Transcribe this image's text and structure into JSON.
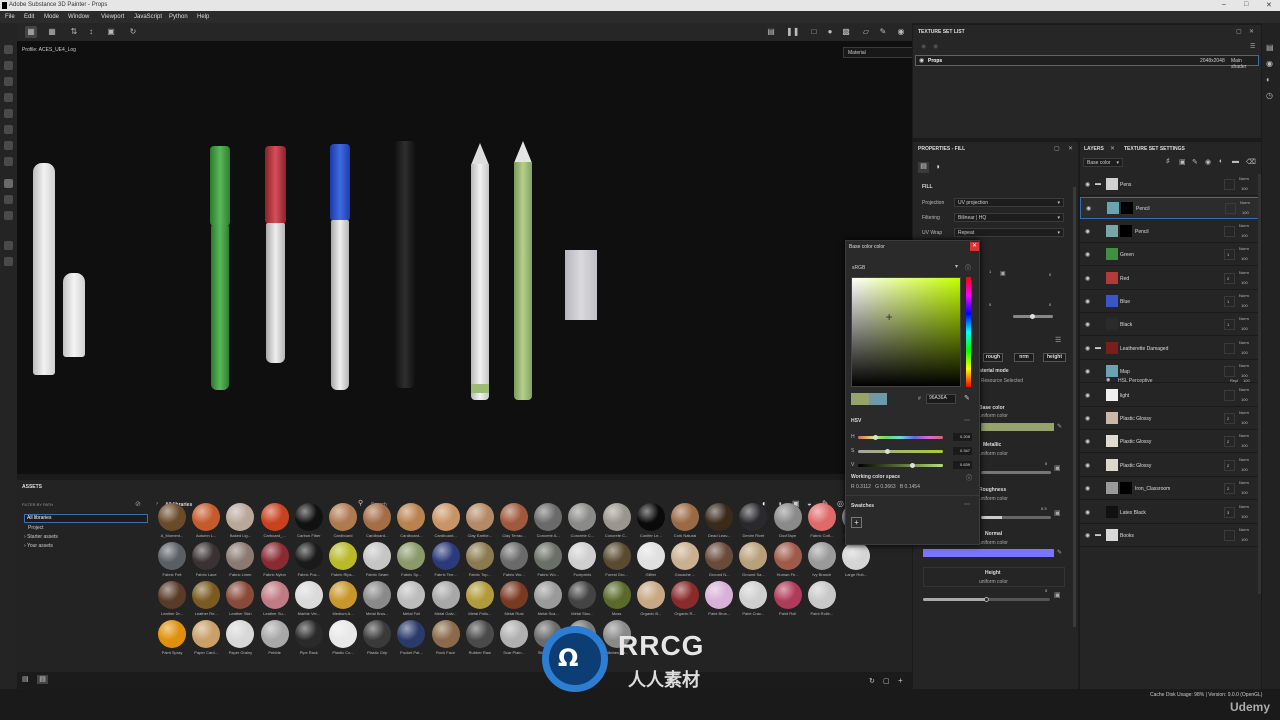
{
  "window": {
    "title": "Adobe Substance 3D Painter - Props"
  },
  "menu": [
    "File",
    "Edit",
    "Mode",
    "Window",
    "Viewport",
    "JavaScript",
    "Python",
    "Help"
  ],
  "viewport": {
    "profile": "Profile: ACES_UE4_Log",
    "display_mode": "Material"
  },
  "texture_set_list": {
    "title": "TEXTURE SET LIST",
    "row": {
      "name": "Props",
      "size": "2048x2048",
      "shader": "Main shader"
    }
  },
  "properties": {
    "title": "PROPERTIES - FILL",
    "section": "FILL",
    "projection_label": "Projection",
    "projection_value": "UV projection",
    "filtering_label": "Filtering",
    "filtering_value": "Bilinear | HQ",
    "uvwrap_label": "UV Wrap",
    "uvwrap_value": "Repeat",
    "channels": [
      "rough",
      "nrm",
      "height"
    ],
    "material_mode_title": "Material mode",
    "material_mode_value": "No Resource Selected",
    "base_color_title": "Base color",
    "base_color_sub": "uniform color",
    "metallic_title": "Metallic",
    "metallic_sub": "uniform color",
    "metallic_value": "0",
    "roughness_title": "Roughness",
    "roughness_sub": "uniform color",
    "roughness_value": "0.3",
    "normal_title": "Normal",
    "normal_sub": "uniform color",
    "height_title": "Height",
    "height_sub": "uniform color",
    "height_value": "0",
    "misc_values": [
      "1",
      "0",
      "0",
      "0"
    ]
  },
  "layers": {
    "tab_layers": "LAYERS",
    "tab_settings": "TEXTURE SET SETTINGS",
    "channel": "Base color",
    "rows": [
      {
        "name": "Pens",
        "blend": "Norm",
        "opacity": "100",
        "color": "#d0d0d0",
        "folder": true
      },
      {
        "name": "Pencil",
        "blend": "Norm",
        "opacity": "100",
        "color": "#6aa3b3",
        "mask": true
      },
      {
        "name": "Pencil",
        "blend": "Norm",
        "opacity": "100",
        "color": "#7aa6a8",
        "mask": true
      },
      {
        "name": "Green",
        "blend": "Norm",
        "opacity": "100",
        "color": "#3f8f3f"
      },
      {
        "name": "Red",
        "blend": "Norm",
        "opacity": "100",
        "color": "#b33a3a"
      },
      {
        "name": "Blue",
        "blend": "Norm",
        "opacity": "100",
        "color": "#3a55c9"
      },
      {
        "name": "Black",
        "blend": "Norm",
        "opacity": "100",
        "color": "#2a2a2a"
      },
      {
        "name": "Leatherette Damaged",
        "blend": "Norm",
        "opacity": "100",
        "color": "#7a1d1d",
        "folder": true
      },
      {
        "name": "Map",
        "blend": "Norm",
        "opacity": "100",
        "color": "#6aa3b3"
      },
      {
        "name": "light",
        "blend": "Norm",
        "opacity": "100",
        "color": "#f0f0f0"
      },
      {
        "name": "Plastic Glossy",
        "blend": "Norm",
        "opacity": "100",
        "color": "#c9b8a8"
      },
      {
        "name": "Plastic Glossy",
        "blend": "Norm",
        "opacity": "100",
        "color": "#e0ddd0"
      },
      {
        "name": "Plastic Glossy",
        "blend": "Norm",
        "opacity": "100",
        "color": "#dcd8cc"
      },
      {
        "name": "Iron_Classroom",
        "blend": "Norm",
        "opacity": "100",
        "color": "#9a9a9a",
        "mask": true
      },
      {
        "name": "Latex Black",
        "blend": "Norm",
        "opacity": "100",
        "color": "#111111"
      },
      {
        "name": "Books",
        "blend": "Norm",
        "opacity": "100",
        "color": "#d9d9d9",
        "folder": true
      }
    ],
    "hsl_effect": {
      "name": "HSL Perceptive",
      "blend": "Repl",
      "opacity": "100"
    },
    "badges": [
      "1",
      "2",
      "1",
      "1",
      "2",
      "2",
      "2",
      "2",
      "3"
    ]
  },
  "color_picker": {
    "title": "Base color color",
    "space": "sRGB",
    "hex": "96A36A",
    "mode": "HSV",
    "h_label": "H",
    "h_value": "0.205",
    "s_label": "S",
    "s_value": "0.347",
    "v_label": "V",
    "v_value": "0.639",
    "working_title": "Working color space",
    "working_values": "R 0.3112   G 0.3663   B 0.1454",
    "swatches_title": "Swatches",
    "hue_fraction": 0.205,
    "sat_fraction": 0.347,
    "val_fraction": 0.639,
    "current_color": "#96A36A"
  },
  "assets": {
    "title": "ASSETS",
    "filter_label": "FILTER BY PATH",
    "tree": [
      "All libraries",
      "Project",
      "Starter assets",
      "Your assets"
    ],
    "breadcrumb": "All libraries",
    "search_placeholder": "Search",
    "materials": [
      {
        "name": "A_Moment...",
        "c": "#6b4a2a"
      },
      {
        "name": "Autumn L...",
        "c": "#c55a2a"
      },
      {
        "name": "Baked Lig...",
        "c": "#b9a89a"
      },
      {
        "name": "Carboard_...",
        "c": "#c8421e"
      },
      {
        "name": "Carbon Fiber",
        "c": "#111"
      },
      {
        "name": "Cardboard",
        "c": "#b07a50"
      },
      {
        "name": "Cardboard...",
        "c": "#a46d46"
      },
      {
        "name": "Cardboard...",
        "c": "#b9824f"
      },
      {
        "name": "Cardboard...",
        "c": "#c99465"
      },
      {
        "name": "Clay Earthe...",
        "c": "#b48a66"
      },
      {
        "name": "Clay Terrac...",
        "c": "#a0593c"
      },
      {
        "name": "Concrete A...",
        "c": "#6a6a6a"
      },
      {
        "name": "Concrete C...",
        "c": "#8a8a88"
      },
      {
        "name": "Concrete C...",
        "c": "#9a958e"
      },
      {
        "name": "Conifer Le...",
        "c": "#0a0a0a"
      },
      {
        "name": "Cork Natural",
        "c": "#9a6a44"
      },
      {
        "name": "Dead Leav...",
        "c": "#3a2a1a"
      },
      {
        "name": "Denim Rivet",
        "c": "#2a2a2e"
      },
      {
        "name": "DuctTape",
        "c": "#8a8a8a"
      },
      {
        "name": "Fabric Cott...",
        "c": "#e06a6a"
      },
      {
        "name": "Fabric Den...",
        "c": "#9aa0b0"
      },
      {
        "name": "Fabric Felt",
        "c": "#5a5f66"
      },
      {
        "name": "Fabric Lace",
        "c": "#3a3232"
      },
      {
        "name": "Fabric Linen",
        "c": "#8a7a72"
      },
      {
        "name": "Fabric Nylon",
        "c": "#8a2a32"
      },
      {
        "name": "Fabric Puc...",
        "c": "#1a1a1a"
      },
      {
        "name": "Fabric Rips...",
        "c": "#b9b92a"
      },
      {
        "name": "Fabric Seam",
        "c": "#c5c5c5"
      },
      {
        "name": "Fabric Sp...",
        "c": "#8a9a6a"
      },
      {
        "name": "Fabric Terr...",
        "c": "#2a3a7a"
      },
      {
        "name": "Fabric Top...",
        "c": "#8a7a50"
      },
      {
        "name": "Fabric Wo...",
        "c": "#6a6a6a"
      },
      {
        "name": "Fabric Wo...",
        "c": "#6a7066"
      },
      {
        "name": "Footprints",
        "c": "#cfcfcf"
      },
      {
        "name": "Forest Gro...",
        "c": "#5a4a30"
      },
      {
        "name": "Glitter",
        "c": "#e0e0e0"
      },
      {
        "name": "Gouache ...",
        "c": "#c8b090"
      },
      {
        "name": "Ground N...",
        "c": "#6a4a3a"
      },
      {
        "name": "Ground Sa...",
        "c": "#b8a07a"
      },
      {
        "name": "Human Fe...",
        "c": "#a05a4a"
      },
      {
        "name": "Ivy Branch",
        "c": "#9a9a9a"
      },
      {
        "name": "Large Rub...",
        "c": "#d5d5d5"
      },
      {
        "name": "Leather Dr...",
        "c": "#5a3a28"
      },
      {
        "name": "Leather Re...",
        "c": "#7a5a20"
      },
      {
        "name": "Leather Skin",
        "c": "#8a4a3a"
      },
      {
        "name": "Leather Su...",
        "c": "#c07a82"
      },
      {
        "name": "Marble Vei...",
        "c": "#dadada"
      },
      {
        "name": "Medium A...",
        "c": "#c8962a"
      },
      {
        "name": "Metal Brus...",
        "c": "#8a8a8a"
      },
      {
        "name": "Metal Foil",
        "c": "#bcbcbc"
      },
      {
        "name": "Metal Galv...",
        "c": "#a8a8a8"
      },
      {
        "name": "Metal Polis...",
        "c": "#b09a3a"
      },
      {
        "name": "Metal Rust",
        "c": "#7a3a22"
      },
      {
        "name": "Metal Sca...",
        "c": "#9a9a9a"
      },
      {
        "name": "Metal Stuc...",
        "c": "#444"
      },
      {
        "name": "Moss",
        "c": "#5a6a2a"
      },
      {
        "name": "Organic B...",
        "c": "#c8a884"
      },
      {
        "name": "Organic R...",
        "c": "#8a2a2a"
      },
      {
        "name": "Paint Brus...",
        "c": "#d8b0d8"
      },
      {
        "name": "Paint Crac...",
        "c": "#cfcfcf"
      },
      {
        "name": "Paint Roll",
        "c": "#b03a5a"
      },
      {
        "name": "Paint Rolle...",
        "c": "#c8c8c8"
      },
      {
        "name": "Paint Spray",
        "c": "#e0900a"
      },
      {
        "name": "Paper Card...",
        "c": "#c8a068"
      },
      {
        "name": "Paper Grainy",
        "c": "#d8d8d8"
      },
      {
        "name": "Pebble",
        "c": "#a8a8a8"
      },
      {
        "name": "Pipe Rack",
        "c": "#2a2a2a"
      },
      {
        "name": "Plastic Co...",
        "c": "#e8e8e8"
      },
      {
        "name": "Plastic Grip",
        "c": "#3a3a3a"
      },
      {
        "name": "Pocket Pat...",
        "c": "#2a3a6a"
      },
      {
        "name": "Rock Face",
        "c": "#8a6a4a"
      },
      {
        "name": "Rubber Raw",
        "c": "#4a4a4a"
      },
      {
        "name": "Scar Plain...",
        "c": "#b0b0b0"
      },
      {
        "name": "Stitches P...",
        "c": "#6a6a6a"
      },
      {
        "name": "Stitches C...",
        "c": "#7a7a7a"
      },
      {
        "name": "Stitches Str...",
        "c": "#8a8a8a"
      }
    ]
  },
  "status": {
    "disk": "Cache Disk Usage:  98% | Version: 9.0.0 (OpenGL)",
    "brand": "Udemy"
  },
  "watermark": {
    "logo": "RRCG",
    "sub": "人人素材"
  }
}
